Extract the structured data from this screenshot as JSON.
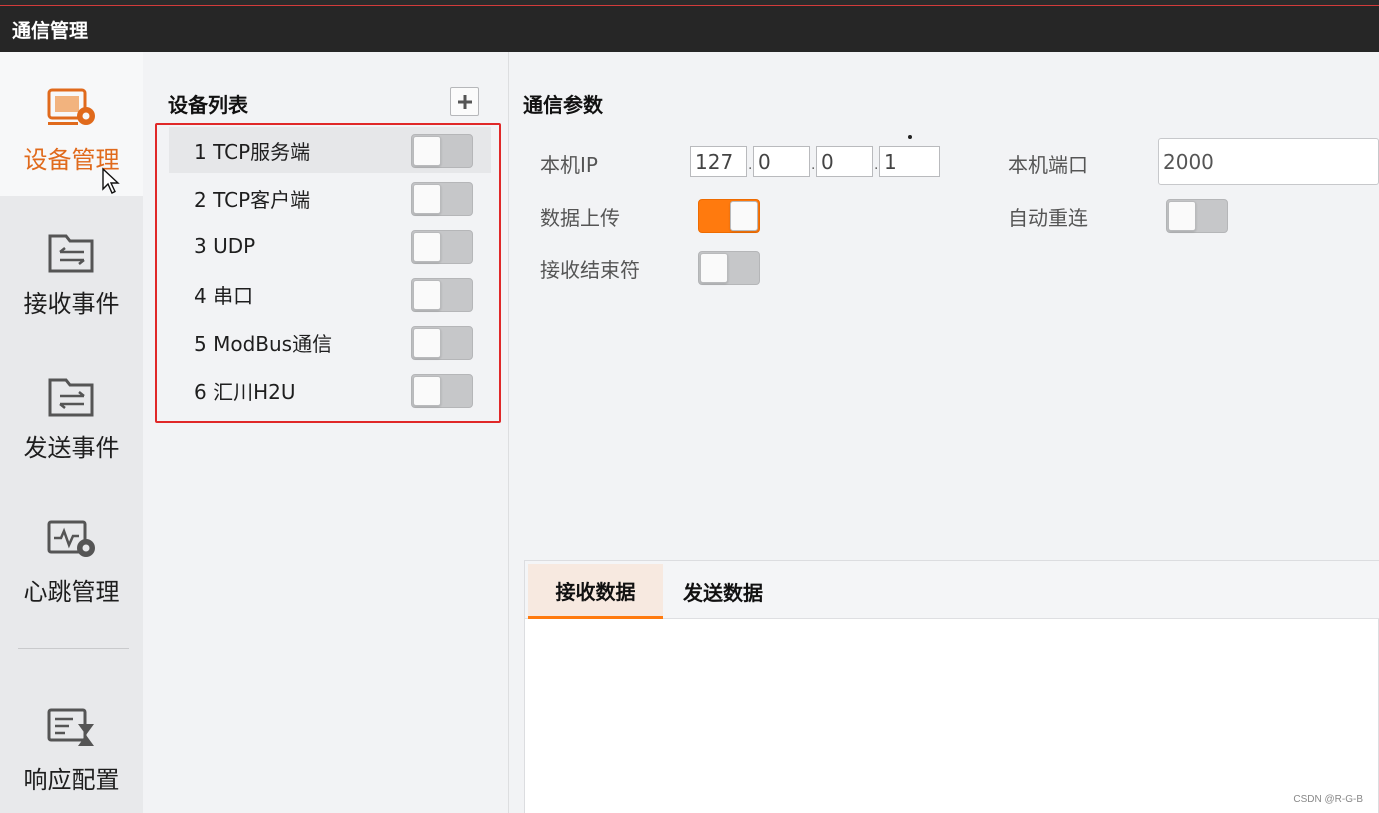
{
  "window": {
    "title": "通信管理"
  },
  "nav": {
    "items": [
      {
        "label": "设备管理",
        "icon": "device-gear-icon",
        "active": true
      },
      {
        "label": "接收事件",
        "icon": "receive-folder-icon",
        "active": false
      },
      {
        "label": "发送事件",
        "icon": "send-folder-icon",
        "active": false
      },
      {
        "label": "心跳管理",
        "icon": "heartbeat-gear-icon",
        "active": false
      },
      {
        "label": "响应配置",
        "icon": "response-hourglass-icon",
        "active": false
      }
    ]
  },
  "device_list": {
    "heading": "设备列表",
    "add_icon": "plus-icon",
    "items": [
      {
        "label": "1 TCP服务端",
        "enabled": false,
        "selected": true
      },
      {
        "label": "2 TCP客户端",
        "enabled": false,
        "selected": false
      },
      {
        "label": "3 UDP",
        "enabled": false,
        "selected": false
      },
      {
        "label": "4 串口",
        "enabled": false,
        "selected": false
      },
      {
        "label": "5 ModBus通信",
        "enabled": false,
        "selected": false
      },
      {
        "label": "6 汇川H2U",
        "enabled": false,
        "selected": false
      }
    ]
  },
  "params": {
    "heading": "通信参数",
    "local_ip_label": "本机IP",
    "ip": [
      "127",
      "0",
      "0",
      "1"
    ],
    "ip_separator": ".",
    "local_port_label": "本机端口",
    "local_port": "2000",
    "data_upload_label": "数据上传",
    "data_upload": true,
    "auto_reconnect_label": "自动重连",
    "auto_reconnect": false,
    "recv_terminator_label": "接收结束符",
    "recv_terminator": false
  },
  "data_tabs": {
    "tabs": [
      {
        "label": "接收数据",
        "active": true
      },
      {
        "label": "发送数据",
        "active": false
      }
    ]
  },
  "watermark": "CSDN @R-G-B",
  "colors": {
    "accent": "#ff7a0e",
    "nav_active_text": "#e06a1c",
    "highlight_border": "#e02828"
  }
}
